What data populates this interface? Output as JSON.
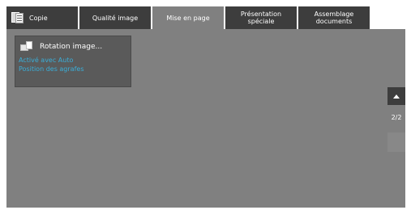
{
  "tabs": [
    {
      "label": "Copie",
      "icon": "copy-icon",
      "active": false
    },
    {
      "label": "Qualité image",
      "active": false
    },
    {
      "label": "Mise en page",
      "active": true
    },
    {
      "label": "Présentation\nspéciale",
      "active": false
    },
    {
      "label": "Assemblage\ndocuments",
      "active": false
    }
  ],
  "feature": {
    "title": "Rotation image...",
    "icon": "rotate-image-icon",
    "line1": "Activé avec Auto",
    "line2": "Position des agrafes"
  },
  "pager": {
    "page": "2/2"
  },
  "colors": {
    "screen_bg": "#808080",
    "tab_bg": "#3d3d3d",
    "accent_text": "#3aaed8"
  }
}
